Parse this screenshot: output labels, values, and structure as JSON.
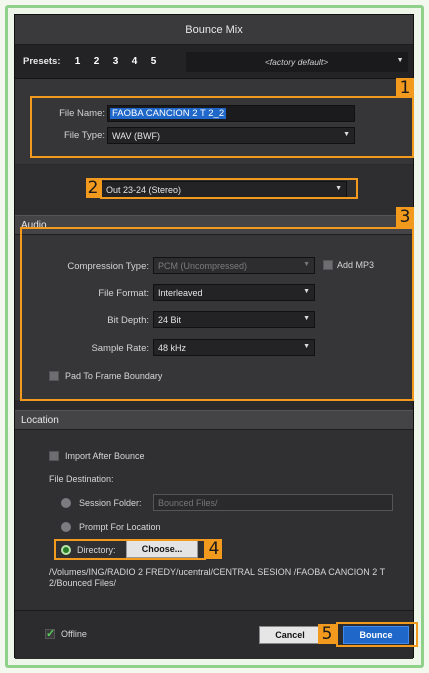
{
  "window": {
    "title": "Bounce Mix"
  },
  "presets": {
    "label": "Presets:",
    "numbers": [
      "1",
      "2",
      "3",
      "4",
      "5"
    ],
    "selected": "<factory default>"
  },
  "file": {
    "name_label": "File Name:",
    "name_value": "FAOBA CANCION 2 T 2_2",
    "type_label": "File Type:",
    "type_value": "WAV (BWF)"
  },
  "output": {
    "value": "Out 23-24 (Stereo)"
  },
  "audio": {
    "header": "Audio",
    "compression_label": "Compression Type:",
    "compression_value": "PCM (Uncompressed)",
    "add_mp3_label": "Add MP3",
    "format_label": "File Format:",
    "format_value": "Interleaved",
    "bit_depth_label": "Bit Depth:",
    "bit_depth_value": "24 Bit",
    "sample_rate_label": "Sample Rate:",
    "sample_rate_value": "48 kHz",
    "pad_label": "Pad To Frame Boundary"
  },
  "location": {
    "header": "Location",
    "import_label": "Import After Bounce",
    "dest_label": "File Destination:",
    "session_label": "Session Folder:",
    "session_placeholder": "Bounced Files/",
    "prompt_label": "Prompt For Location",
    "directory_label": "Directory:",
    "choose_label": "Choose...",
    "path": "/Volumes/ING/RADIO 2 FREDY/ucentral/CENTRAL SESION /FAOBA CANCION 2 T 2/Bounced Files/"
  },
  "footer": {
    "offline_label": "Offline",
    "cancel_label": "Cancel",
    "bounce_label": "Bounce"
  },
  "annotations": [
    "1",
    "2",
    "3",
    "4",
    "5"
  ],
  "colors": {
    "highlight": "#f29a1e",
    "accent_blue": "#1f67c8",
    "frame_green": "#8fd18a"
  }
}
